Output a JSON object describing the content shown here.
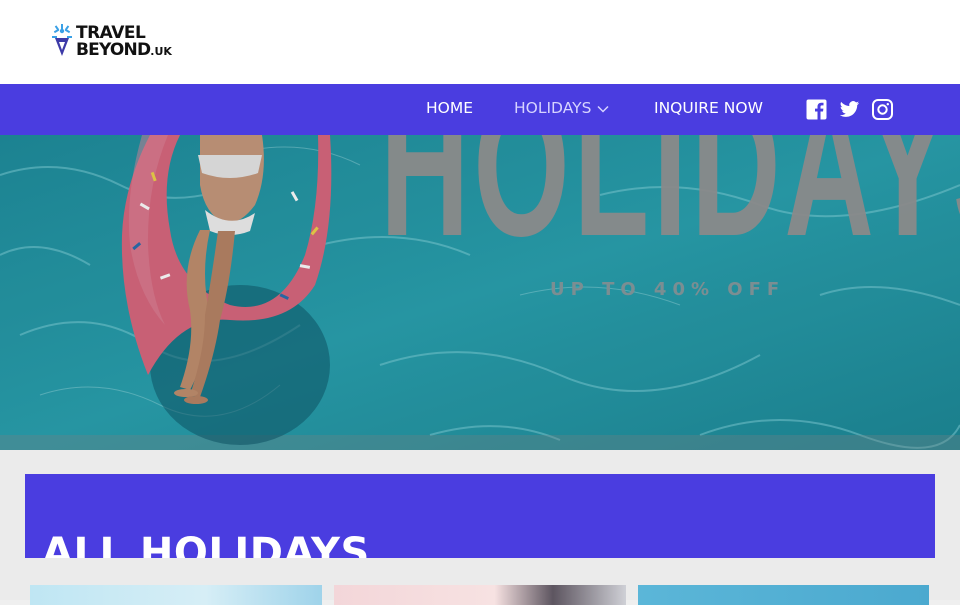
{
  "header": {
    "logo": {
      "line1": "TRAVEL",
      "line2": "BEYOND",
      "suffix": ".UK",
      "icon": "star-figure-logo-icon"
    }
  },
  "nav": {
    "items": [
      {
        "label": "HOME"
      },
      {
        "label": "HOLIDAYS",
        "has_dropdown": true,
        "icon": "chevron-down-icon"
      },
      {
        "label": "INQUIRE NOW"
      }
    ],
    "social": [
      "facebook-icon",
      "twitter-icon",
      "instagram-icon"
    ],
    "colors": {
      "bar": "#4a3de0",
      "text": "#ffffff",
      "active_text": "#d6d3ff"
    }
  },
  "hero": {
    "title": "HOLIDAYS",
    "subtitle": "UP TO 40% OFF",
    "colors": {
      "water": "#2a9aa6",
      "float": "#d06a80"
    }
  },
  "section": {
    "title": "ALL HOLIDAYS",
    "background": "#4a3de0"
  },
  "cards": [
    {
      "name": "holiday-card-1"
    },
    {
      "name": "holiday-card-2"
    },
    {
      "name": "holiday-card-3"
    }
  ]
}
